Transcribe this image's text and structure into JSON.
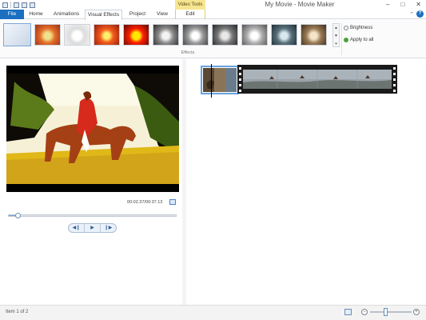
{
  "titlebar": {
    "context_label": "Video Tools",
    "window_title": "My Movie - Movie Maker",
    "controls": [
      "–",
      "□",
      "✕"
    ]
  },
  "tabs": {
    "file": "File",
    "home": "Home",
    "animations": "Animations",
    "visual_effects": "Visual Effects",
    "project": "Project",
    "view": "View",
    "edit": "Edit",
    "active": "Visual Effects"
  },
  "ribbon": {
    "effects_label": "Effects",
    "brightness_label": "Brightness",
    "apply_all_label": "Apply to all",
    "effects": [
      {
        "name": "No effect",
        "selected": true
      },
      {
        "name": "Blur"
      },
      {
        "name": "Edge detection"
      },
      {
        "name": "Warm"
      },
      {
        "name": "Posterize"
      },
      {
        "name": "Black and white"
      },
      {
        "name": "Black and white - orange filter"
      },
      {
        "name": "Black and white - red filter"
      },
      {
        "name": "Black and white - yellow filter"
      },
      {
        "name": "Cyan"
      },
      {
        "name": "Sepia"
      }
    ]
  },
  "player": {
    "time": "00:02.37/00:37.13",
    "seek_fraction": 0.064,
    "transport": [
      "◀❙",
      "▶",
      "❙▶"
    ]
  },
  "status": {
    "text": "Item 1 of 2",
    "zoom_out": "−",
    "zoom_in": "+"
  },
  "colors": {
    "accent": "#1b6fc1",
    "context_tab": "#f6e690"
  }
}
